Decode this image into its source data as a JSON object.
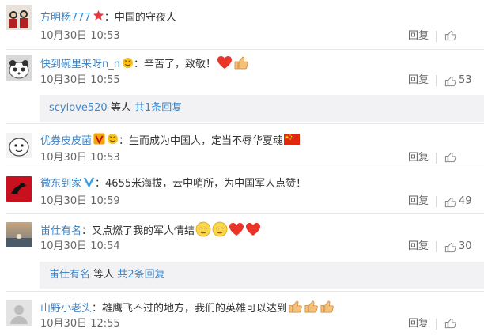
{
  "comments": [
    {
      "user": "方明杨777",
      "text": "中国的守夜人",
      "date": "10月30日",
      "time": "10:53",
      "reply": "回复",
      "likes": ""
    },
    {
      "user": "快到碗里来呀n_n",
      "text": "辛苦了，致敬！",
      "date": "10月30日",
      "time": "10:55",
      "reply": "回复",
      "likes": "53",
      "sub": {
        "user": "scylove520",
        "mid": "等人",
        "link": "共1条回复"
      }
    },
    {
      "user": "优券皮皮菌",
      "text": "生而成为中国人，定当不辱华夏魂",
      "date": "10月30日",
      "time": "10:53",
      "reply": "回复",
      "likes": ""
    },
    {
      "user": "微东到家",
      "text": "4655米海拔，云中哨所，为中国军人点赞！",
      "date": "10月30日",
      "time": "10:59",
      "reply": "回复",
      "likes": "49"
    },
    {
      "user": "峀仕有名",
      "text": "又点燃了我的军人情结",
      "date": "10月30日",
      "time": "10:54",
      "reply": "回复",
      "likes": "30",
      "sub": {
        "user": "峀仕有名",
        "mid": "等人",
        "link": "共2条回复"
      }
    },
    {
      "user": "山野小老头",
      "text": "雄鹰飞不过的地方，我们的英雄可以达到",
      "date": "10月30日",
      "time": "12:55",
      "reply": "回复",
      "likes": ""
    }
  ],
  "colors": {
    "orange_name": "#eb7350",
    "blue_name": "#3f86c8",
    "meta": "#666666",
    "subbox_bg": "#f2f2f5"
  },
  "icons": [
    "thumbs-up-icon",
    "star-icon",
    "verified-v-icon",
    "heart-icon",
    "clap-icon",
    "china-flag-icon"
  ]
}
